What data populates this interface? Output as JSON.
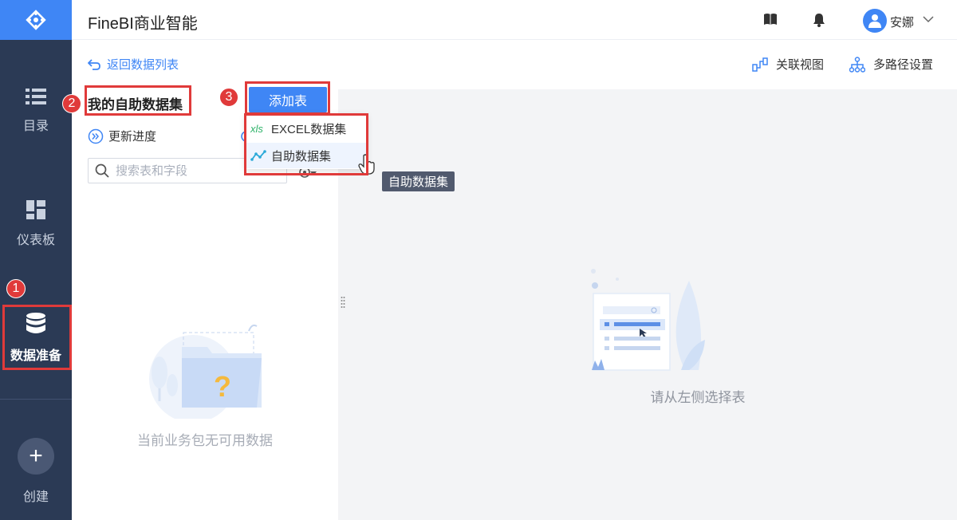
{
  "app": {
    "title": "FineBI商业智能"
  },
  "header": {
    "user_name": "安娜",
    "icons": [
      "book-icon",
      "bell-icon",
      "user-avatar-icon",
      "chevron-down-icon"
    ]
  },
  "nav": {
    "items": [
      {
        "label": "目录",
        "icon": "list-icon"
      },
      {
        "label": "仪表板",
        "icon": "dashboard-icon"
      },
      {
        "label": "数据准备",
        "icon": "database-icon"
      }
    ],
    "create_label": "创建"
  },
  "left_panel": {
    "back_label": "返回数据列表",
    "dataset_title": "我的自助数据集",
    "update_progress_label": "更新进度",
    "search": {
      "placeholder": "搜索表和字段",
      "value": ""
    },
    "empty_text": "当前业务包无可用数据"
  },
  "add_table": {
    "label": "添加表",
    "menu": [
      {
        "label": "EXCEL数据集",
        "icon": "xls-icon"
      },
      {
        "label": "自助数据集",
        "icon": "line-chart-icon"
      }
    ],
    "tooltip": "自助数据集"
  },
  "toolbar": {
    "relation_view_label": "关联视图",
    "multipath_label": "多路径设置"
  },
  "main": {
    "empty_text": "请从左侧选择表"
  },
  "annotations": {
    "badges": [
      "1",
      "2",
      "3"
    ],
    "color": "#e03a3a"
  },
  "colors": {
    "accent": "#3f86f5",
    "nav_bg": "#2b3a55"
  }
}
